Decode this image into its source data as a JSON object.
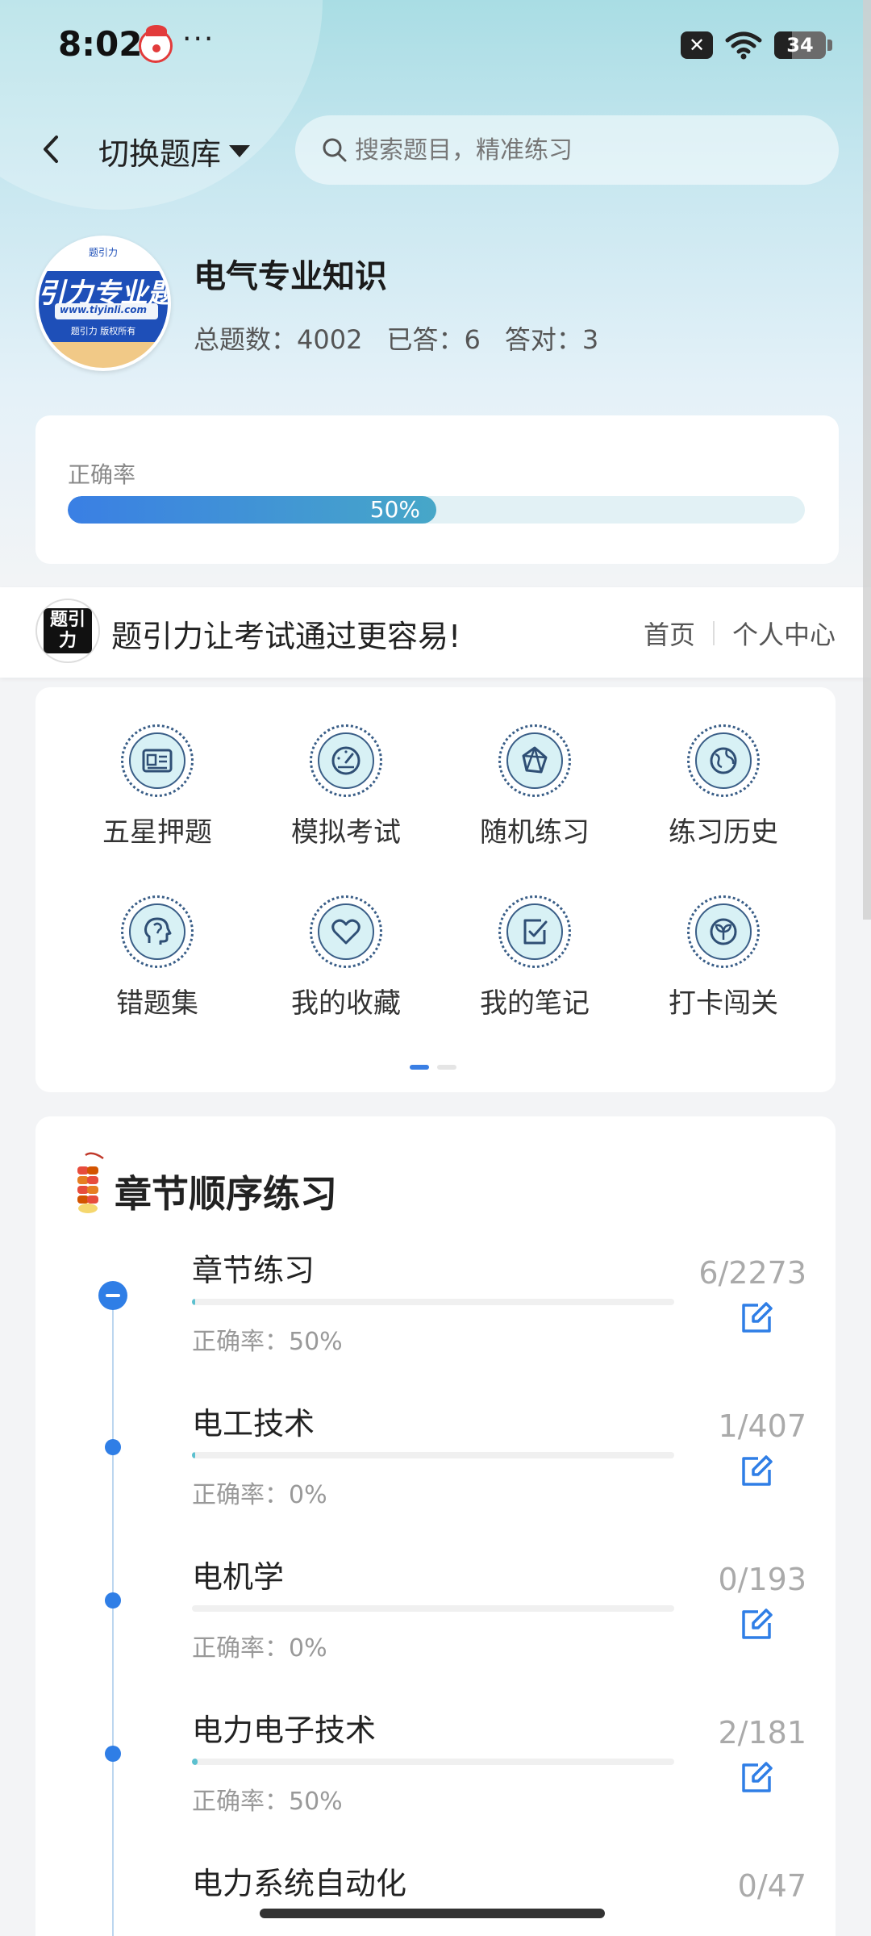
{
  "status": {
    "time": "8:02",
    "more": "···",
    "battery": "34"
  },
  "topbar": {
    "bank_switch_label": "切换题库",
    "search_placeholder": "搜索题目，精准练习"
  },
  "course": {
    "logo_title": "引力专业题",
    "logo_top": "题引力",
    "logo_url": "www.tiyinli.com",
    "logo_copyright": "题引力 版权所有",
    "name": "电气专业知识",
    "total": "总题数：4002",
    "answered": "已答：6",
    "correct": "答对：3"
  },
  "accuracy": {
    "label": "正确率",
    "value_text": "50%",
    "value": 0.5
  },
  "banner": {
    "logo_text": "题引力",
    "slogan": "题引力让考试通过更容易!",
    "home": "首页",
    "profile": "个人中心"
  },
  "features": [
    {
      "label": "五星押题",
      "icon": "id-card-icon"
    },
    {
      "label": "模拟考试",
      "icon": "gauge-icon"
    },
    {
      "label": "随机练习",
      "icon": "shuffle-icon"
    },
    {
      "label": "练习历史",
      "icon": "globe-icon"
    },
    {
      "label": "错题集",
      "icon": "head-icon"
    },
    {
      "label": "我的收藏",
      "icon": "heart-icon"
    },
    {
      "label": "我的笔记",
      "icon": "note-check-icon"
    },
    {
      "label": "打卡闯关",
      "icon": "leaf-icon"
    }
  ],
  "chapters": {
    "title": "章节顺序练习",
    "items": [
      {
        "name": "章节练习",
        "accuracy": "正确率：50%",
        "count": "6/2273",
        "progress": 0.0026
      },
      {
        "name": "电工技术",
        "accuracy": "正确率：0%",
        "count": "1/407",
        "progress": 0.0025
      },
      {
        "name": "电机学",
        "accuracy": "正确率：0%",
        "count": "0/193",
        "progress": 0
      },
      {
        "name": "电力电子技术",
        "accuracy": "正确率：50%",
        "count": "2/181",
        "progress": 0.011
      },
      {
        "name": "电力系统自动化",
        "accuracy": "",
        "count": "0/47",
        "progress": 0
      }
    ]
  },
  "colors": {
    "accent": "#2f7ee6",
    "teal": "#47a7c8"
  }
}
